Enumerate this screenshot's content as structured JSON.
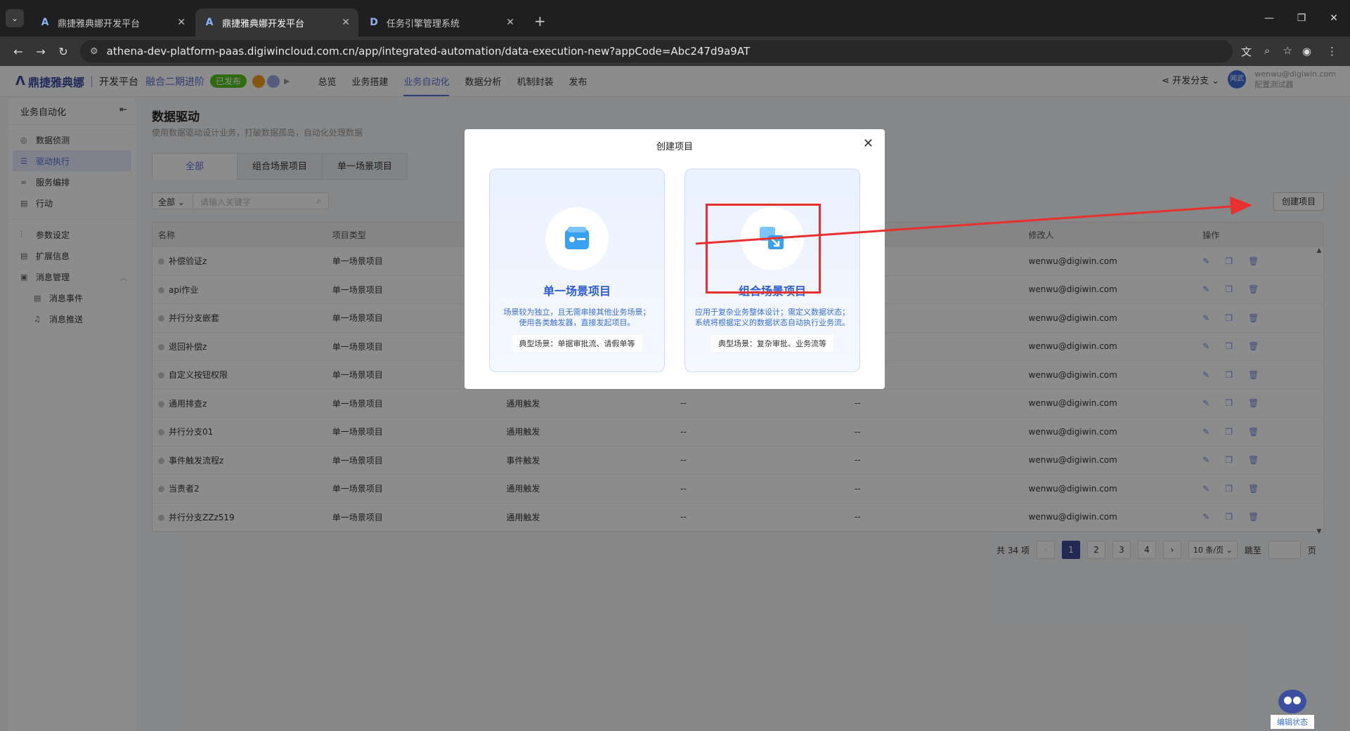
{
  "browser": {
    "tabs": [
      {
        "title": "鼎捷雅典娜开发平台",
        "favicon": "A",
        "active": false
      },
      {
        "title": "鼎捷雅典娜开发平台",
        "favicon": "A",
        "active": true
      },
      {
        "title": "任务引擎管理系统",
        "favicon": "D",
        "active": false
      }
    ],
    "url": "athena-dev-platform-paas.digiwincloud.com.cn/app/integrated-automation/data-execution-new?appCode=Abc247d9a9AT"
  },
  "header": {
    "logo": "鼎捷雅典娜",
    "platform": "开发平台",
    "project": "融合二期进阶",
    "status_badge": "已发布",
    "nav": [
      "总览",
      "业务搭建",
      "业务自动化",
      "数据分析",
      "机制封装",
      "发布"
    ],
    "active_nav": "业务自动化",
    "branch": "开发分支",
    "user_email": "wenwu@digiwin.com",
    "user_role": "配置测试器",
    "avatar_text": "闻武"
  },
  "sidebar": {
    "title": "业务自动化",
    "items": [
      {
        "label": "数据侦测",
        "icon": "radar-icon"
      },
      {
        "label": "驱动执行",
        "icon": "stack-icon",
        "active": true
      },
      {
        "label": "服务编排",
        "icon": "link-icon"
      },
      {
        "label": "行动",
        "icon": "doc-icon"
      }
    ],
    "items2": [
      {
        "label": "参数设定",
        "icon": "sliders-icon"
      },
      {
        "label": "扩展信息",
        "icon": "doc-icon"
      },
      {
        "label": "消息管理",
        "icon": "message-icon"
      }
    ],
    "sub_items": [
      {
        "label": "消息事件",
        "icon": "event-icon"
      },
      {
        "label": "消息推送",
        "icon": "bell-icon"
      }
    ]
  },
  "main": {
    "title": "数据驱动",
    "description": "使用数据驱动设计业务，打破数据孤岛，自动化处理数据",
    "tabs": [
      "全部",
      "组合场景项目",
      "单一场景项目"
    ],
    "filter_select": "全部",
    "search_placeholder": "请输入关键字",
    "create_button": "创建项目",
    "columns": [
      "名称",
      "项目类型",
      "",
      "",
      "",
      "修改人",
      "操作"
    ],
    "rows": [
      {
        "name": "补偿验证z",
        "type": "单一场景项目",
        "trigger": "",
        "c4": "",
        "c5": "",
        "modifier": "wenwu@digiwin.com"
      },
      {
        "name": "api作业",
        "type": "单一场景项目",
        "trigger": "",
        "c4": "",
        "c5": "",
        "modifier": "wenwu@digiwin.com"
      },
      {
        "name": "并行分支嵌套",
        "type": "单一场景项目",
        "trigger": "",
        "c4": "",
        "c5": "",
        "modifier": "wenwu@digiwin.com"
      },
      {
        "name": "退回补偿z",
        "type": "单一场景项目",
        "trigger": "",
        "c4": "",
        "c5": "",
        "modifier": "wenwu@digiwin.com"
      },
      {
        "name": "自定义按钮权限",
        "type": "单一场景项目",
        "trigger": "",
        "c4": "",
        "c5": "",
        "modifier": "wenwu@digiwin.com"
      },
      {
        "name": "通用排查z",
        "type": "单一场景项目",
        "trigger": "通用触发",
        "c4": "--",
        "c5": "--",
        "modifier": "wenwu@digiwin.com"
      },
      {
        "name": "并行分支01",
        "type": "单一场景项目",
        "trigger": "通用触发",
        "c4": "--",
        "c5": "--",
        "modifier": "wenwu@digiwin.com"
      },
      {
        "name": "事件触发流程z",
        "type": "单一场景项目",
        "trigger": "事件触发",
        "c4": "--",
        "c5": "--",
        "modifier": "wenwu@digiwin.com"
      },
      {
        "name": "当责者2",
        "type": "单一场景项目",
        "trigger": "通用触发",
        "c4": "--",
        "c5": "--",
        "modifier": "wenwu@digiwin.com"
      },
      {
        "name": "并行分支ZZz519",
        "type": "单一场景项目",
        "trigger": "通用触发",
        "c4": "--",
        "c5": "--",
        "modifier": "wenwu@digiwin.com"
      }
    ],
    "pagination": {
      "total": "共 34 项",
      "pages": [
        "1",
        "2",
        "3",
        "4"
      ],
      "current": "1",
      "per_page": "10 条/页",
      "jump_label": "跳至",
      "page_suffix": "页"
    }
  },
  "modal": {
    "title": "创建项目",
    "cards": [
      {
        "title": "单一场景项目",
        "desc_line1": "场景较为独立，且无需串接其他业务场景；",
        "desc_line2": "使用各类触发器，直接发起项目。",
        "tag": "典型场景：单据审批流、请假单等"
      },
      {
        "title": "组合场景项目",
        "desc_line1": "应用于复杂业务整体设计；需定义数据状态；",
        "desc_line2": "系统将根据定义的数据状态自动执行业务流。",
        "tag": "典型场景：复杂审批、业务流等"
      }
    ]
  },
  "assistant": {
    "label": "编辑状态"
  },
  "colors": {
    "accent": "#5b6fd6",
    "annotation": "#e8302e",
    "published": "#52c41a"
  }
}
